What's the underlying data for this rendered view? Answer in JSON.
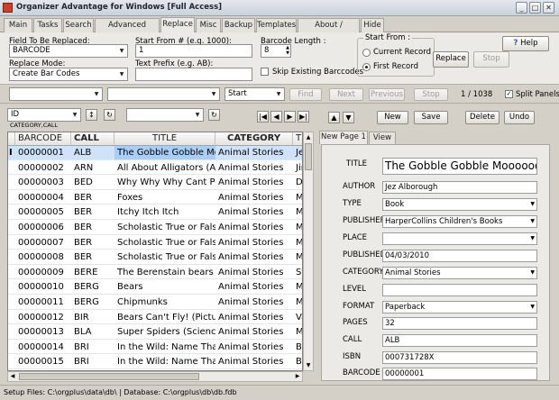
{
  "window": {
    "title": "Organizer Advantage for Windows [Full Access]",
    "minimize": "_",
    "maximize": "□",
    "close": "✕"
  },
  "tabs": [
    "Main",
    "Tasks",
    "Search",
    "Advanced Search",
    "Replace",
    "Misc",
    "Backup",
    "Templates",
    "About / Upgrade",
    "Hide"
  ],
  "active_tab": "Replace",
  "replace_panel": {
    "field_label": "Field To Be Replaced:",
    "field_value": "BARCODE",
    "mode_label": "Replace Mode:",
    "mode_value": "Create Bar Codes",
    "start_from_num_label": "Start From # (e.g. 1000):",
    "start_from_num_value": "1",
    "prefix_label": "Text Prefix (e.g. AB):",
    "prefix_value": "",
    "barcode_length_label": "Barcode Length :",
    "barcode_length_value": "8",
    "skip_existing_label": "Skip Existing Barccodes",
    "start_from_label": "Start From :",
    "current_record_label": "Current Record",
    "first_record_label": "First Record",
    "selected_start": "First Record",
    "replace_button": "Replace",
    "stop_button": "Stop",
    "help_button": "Help"
  },
  "search_bar": {
    "start_value": "Start",
    "find": "Find",
    "next": "Next",
    "previous": "Previous",
    "stop": "Stop",
    "record_position": "1 / 1038",
    "split_panels": "Split Panels"
  },
  "left_toolbar": {
    "sort_field": "ID",
    "sort_sub": "CATEGORY,CALL"
  },
  "grid": {
    "columns": [
      "BARCODE",
      "CALL",
      "TITLE",
      "CATEGORY",
      "TH"
    ],
    "rows": [
      [
        "00000001",
        "ALB",
        "The Gobble Gobble Mo",
        "Animal Stories",
        "Jez"
      ],
      [
        "00000002",
        "ARN",
        "All About Alligators (Al",
        "Animal Stories",
        "Jim"
      ],
      [
        "00000003",
        "BED",
        "Why Why Why Cant Pe",
        "Animal Stories",
        "De"
      ],
      [
        "00000004",
        "BER",
        "Foxes",
        "Animal Stories",
        "Me"
      ],
      [
        "00000005",
        "BER",
        "Itchy Itch Itch",
        "Animal Stories",
        "Mel"
      ],
      [
        "00000006",
        "BER",
        "Scholastic True or False",
        "Animal Stories",
        "Mel"
      ],
      [
        "00000007",
        "BER",
        "Scholastic True or False",
        "Animal Stories",
        "Mel"
      ],
      [
        "00000008",
        "BER",
        "Scholastic True or False",
        "Animal Stories",
        "Mel"
      ],
      [
        "00000009",
        "BERE",
        "The Berenstain bears b",
        "Animal Stories",
        "Sta"
      ],
      [
        "00000010",
        "BERG",
        "Bears",
        "Animal Stories",
        "Ma"
      ],
      [
        "00000011",
        "BERG",
        "Chipmunks",
        "Animal Stories",
        "Ma"
      ],
      [
        "00000012",
        "BIR",
        "Bears Can't Fly! (Picture",
        "Animal Stories",
        "Val"
      ],
      [
        "00000013",
        "BLA",
        "Super Spiders (Science",
        "Animal Stories",
        "Ma"
      ],
      [
        "00000014",
        "BRI",
        "In the Wild: Name That",
        "Animal Stories",
        "Brin"
      ],
      [
        "00000015",
        "BRI",
        "In the Wild: Name That",
        "Animal Stories",
        "Brin"
      ]
    ],
    "row_indicator": "I"
  },
  "right_toolbar": {
    "new": "New",
    "save": "Save",
    "delete": "Delete",
    "undo": "Undo"
  },
  "detail_tabs": [
    "New Page 1",
    "View"
  ],
  "record": {
    "title_label": "TITLE",
    "title": "The Gobble Gobble Moooooo T",
    "author_label": "AUTHOR",
    "author": "Jez Alborough",
    "type_label": "TYPE",
    "type": "Book",
    "publisher_label": "PUBLISHER",
    "publisher": "HarperCollins Children's Books",
    "place_label": "PLACE",
    "place": "",
    "published_label": "PUBLISHED",
    "published": "04/03/2010",
    "category_label": "CATEGORY",
    "category": "Animal Stories",
    "level_label": "LEVEL",
    "level": "",
    "format_label": "FORMAT",
    "format": "Paperback",
    "pages_label": "PAGES",
    "pages": "32",
    "call_label": "CALL",
    "call": "ALB",
    "isbn_label": "ISBN",
    "isbn": "000731728X",
    "barcode_label": "BARCODE",
    "barcode": "00000001"
  },
  "status": {
    "text": "Setup Files: C:\\orgplus\\data\\db\\ | Database: C:\\orgplus\\db\\db.fdb"
  }
}
